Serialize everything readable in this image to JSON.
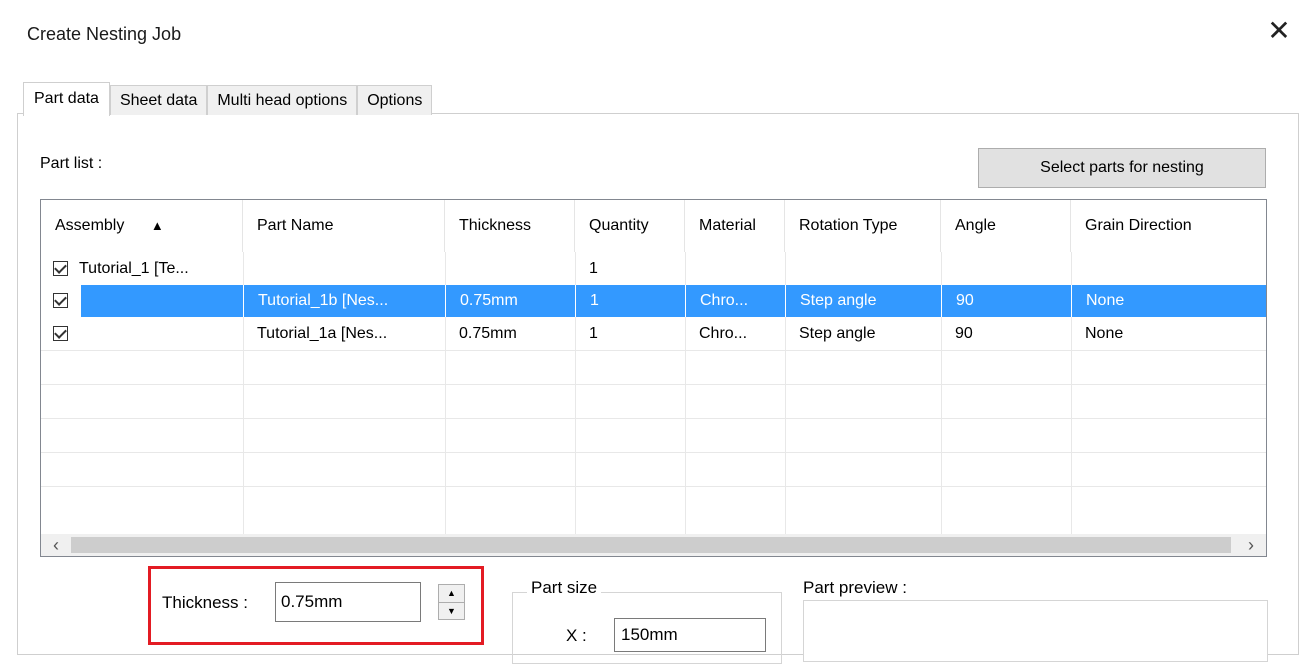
{
  "window": {
    "title": "Create Nesting Job",
    "close_icon": "close-icon"
  },
  "tabs": [
    {
      "label": "Part data",
      "active": true
    },
    {
      "label": "Sheet data",
      "active": false
    },
    {
      "label": "Multi head options",
      "active": false
    },
    {
      "label": "Options",
      "active": false
    }
  ],
  "part_list_label": "Part list :",
  "select_parts_button": "Select parts for nesting",
  "table": {
    "columns": [
      "Assembly",
      "Part Name",
      "Thickness",
      "Quantity",
      "Material",
      "Rotation Type",
      "Angle",
      "Grain Direction"
    ],
    "sort_indicator": "▲",
    "rows": [
      {
        "checked": true,
        "assembly": "Tutorial_1 [Te...",
        "part_name": "",
        "thickness": "",
        "quantity": "1",
        "material": "",
        "rotation_type": "",
        "angle": "",
        "grain_direction": "",
        "selected": false
      },
      {
        "checked": true,
        "assembly": "",
        "part_name": "Tutorial_1b [Nes...",
        "thickness": "0.75mm",
        "quantity": "1",
        "material": "Chro...",
        "rotation_type": "Step angle",
        "angle": "90",
        "grain_direction": "None",
        "selected": true
      },
      {
        "checked": true,
        "assembly": "",
        "part_name": "Tutorial_1a [Nes...",
        "thickness": "0.75mm",
        "quantity": "1",
        "material": "Chro...",
        "rotation_type": "Step angle",
        "angle": "90",
        "grain_direction": "None",
        "selected": false
      }
    ]
  },
  "thickness": {
    "label": "Thickness :",
    "value": "0.75mm"
  },
  "part_size": {
    "title": "Part size",
    "x_label": "X :",
    "x_value": "150mm"
  },
  "part_preview": {
    "label": "Part preview :"
  }
}
